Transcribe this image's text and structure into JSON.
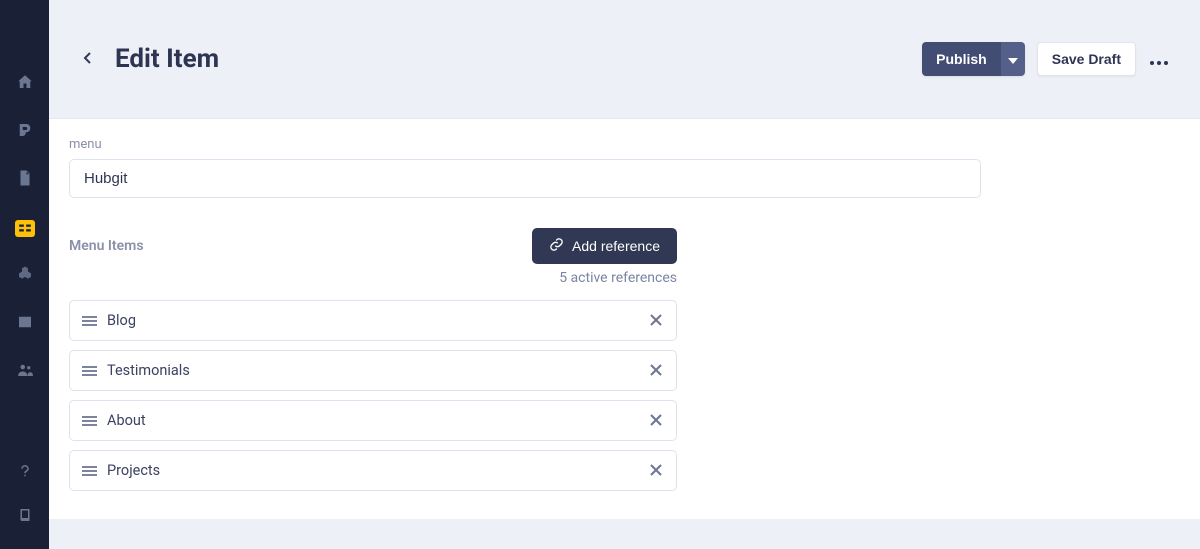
{
  "sidebar": {
    "items": [
      {
        "name": "home"
      },
      {
        "name": "blog"
      },
      {
        "name": "document"
      },
      {
        "name": "cards",
        "active": true
      },
      {
        "name": "blocks"
      },
      {
        "name": "media"
      },
      {
        "name": "team"
      }
    ],
    "bottom": [
      {
        "name": "help"
      },
      {
        "name": "book"
      }
    ]
  },
  "header": {
    "title": "Edit Item",
    "publish_label": "Publish",
    "save_draft_label": "Save Draft"
  },
  "form": {
    "menu_label": "menu",
    "menu_value": "Hubgit",
    "section_title": "Menu Items",
    "add_reference_label": "Add reference",
    "reference_count_text": "5 active references",
    "items": [
      {
        "label": "Blog"
      },
      {
        "label": "Testimonials"
      },
      {
        "label": "About"
      },
      {
        "label": "Projects"
      }
    ]
  }
}
